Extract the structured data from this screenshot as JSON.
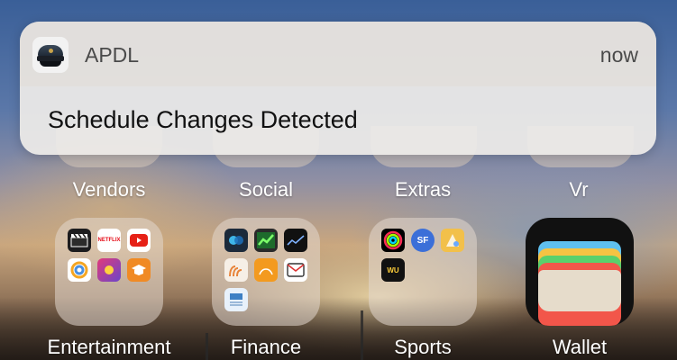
{
  "notification": {
    "app_name": "APDL",
    "time": "now",
    "message": "Schedule Changes Detected",
    "app_icon": "pilot-cap-icon"
  },
  "top_row": [
    {
      "label": "Vendors"
    },
    {
      "label": "Social"
    },
    {
      "label": "Extras"
    },
    {
      "label": "Vr"
    }
  ],
  "bottom_row": [
    {
      "label": "Entertainment",
      "apps": [
        {
          "icon": "clapperboard-icon",
          "text": "",
          "color": "#1c1c1e"
        },
        {
          "icon": "netflix-icon",
          "text": "NETFLIX",
          "color": "#ffffff"
        },
        {
          "icon": "youtube-icon",
          "text": "",
          "color": "#ffffff"
        },
        {
          "icon": "photo-icon",
          "text": "",
          "color": "#ffffff"
        },
        {
          "icon": "game-icon",
          "text": "",
          "color": "#6b45c9"
        },
        {
          "icon": "graduation-cap-icon",
          "text": "",
          "color": "#f08a24"
        }
      ]
    },
    {
      "label": "Finance",
      "apps": [
        {
          "icon": "circles-icon",
          "text": "",
          "color": "#1c2a3a"
        },
        {
          "icon": "chart-up-icon",
          "text": "",
          "color": "#2a2a2a"
        },
        {
          "icon": "stocks-icon",
          "text": "",
          "color": "#111111"
        },
        {
          "icon": "hands-icon",
          "text": "",
          "color": "#f6efe6"
        },
        {
          "icon": "orange-app-icon",
          "text": "",
          "color": "#f39a1f"
        },
        {
          "icon": "mail-icon",
          "text": "",
          "color": "#ffffff"
        },
        {
          "icon": "bank-icon",
          "text": "",
          "color": "#e8f1fb"
        }
      ]
    },
    {
      "label": "Sports",
      "apps": [
        {
          "icon": "activity-rings-icon",
          "text": "",
          "color": "#000000"
        },
        {
          "icon": "sf-icon",
          "text": "SF",
          "color": "#3b6fd8"
        },
        {
          "icon": "golf-icon",
          "text": "",
          "color": "#f2c04a"
        },
        {
          "icon": "wu-icon",
          "text": "WU",
          "color": "#111111"
        }
      ]
    },
    {
      "label": "Wallet"
    }
  ],
  "colors": {
    "notif_title": "#4a4a4a",
    "notif_body": "#111111",
    "label": "#ffffff"
  }
}
